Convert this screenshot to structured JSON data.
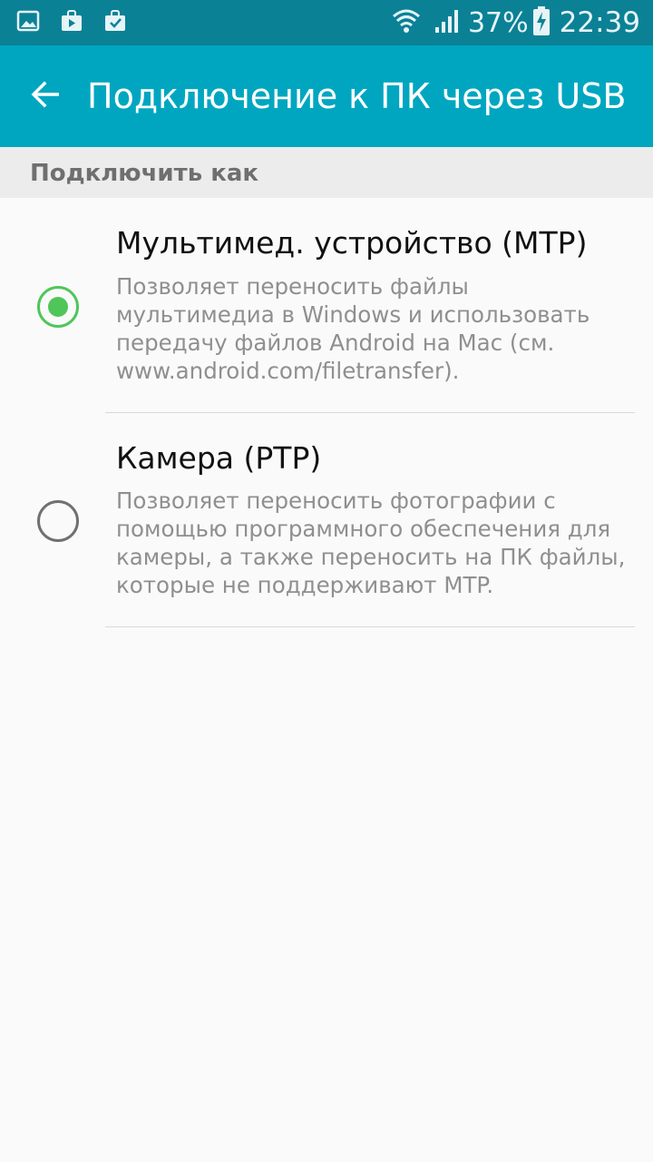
{
  "status_bar": {
    "icons_left": [
      "gallery-icon",
      "play-store-icon",
      "clipboard-check-icon"
    ],
    "icons_right": [
      "wifi-icon",
      "cell-signal-icon"
    ],
    "battery_percent": "37%",
    "battery_icon": "battery-charging-icon",
    "time": "22:39"
  },
  "app_bar": {
    "back_icon": "arrow-back-icon",
    "title": "Подключение к ПК через USB",
    "background_color": "#00a6c0"
  },
  "section": {
    "title": "Подключить как"
  },
  "options": [
    {
      "title": "Мультимед. устройство (MTP)",
      "description": [
        "Позволяет переносить файлы",
        "мультимедиа в Windows и использовать",
        "передачу файлов Android на Mac (см.",
        "www.android.com/filetransfer)."
      ],
      "selected": true
    },
    {
      "title": "Камера (PTP)",
      "description": [
        "Позволяет переносить фотографии с",
        "помощью программного обеспечения для",
        "камеры, а также переносить на ПК файлы,",
        "которые не поддерживают MTP."
      ],
      "selected": false
    }
  ],
  "accent_color": "#4fc65a"
}
